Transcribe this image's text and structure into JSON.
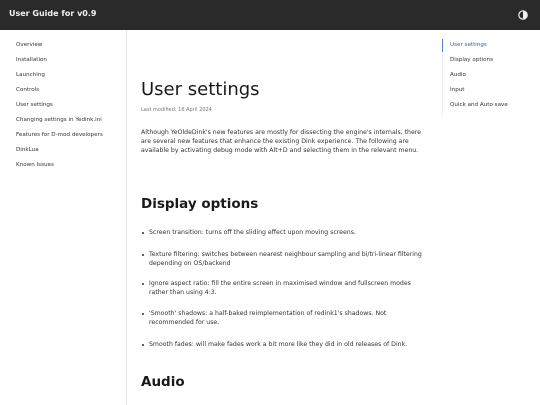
{
  "header": {
    "title": "User Guide for v0.9",
    "theme_toggle_icon": "half-circle-contrast-icon"
  },
  "sidebar": {
    "items": [
      {
        "label": "Overview"
      },
      {
        "label": "Installation"
      },
      {
        "label": "Launching"
      },
      {
        "label": "Controls"
      },
      {
        "label": "User settings"
      },
      {
        "label": "Changing settings in Yedink.ini"
      },
      {
        "label": "Features for D-mod developers"
      },
      {
        "label": "DinkLua"
      },
      {
        "label": "Known Issues"
      }
    ]
  },
  "toc": {
    "items": [
      {
        "label": "User settings",
        "active": true
      },
      {
        "label": "Display options"
      },
      {
        "label": "Audio"
      },
      {
        "label": "Input"
      },
      {
        "label": "Quick and Auto save"
      }
    ],
    "accent": "#4b7fd1"
  },
  "main": {
    "title": "User settings",
    "last_modified": "Last modified: 16 April 2024",
    "intro": "Although YeOldeDink's new features are mostly for dissecting the engine's internals, there are several new features that enhance the existing Dink experience. The following are available by activating debug mode with Alt+D and selecting them in the relevant menu.",
    "display_heading": "Display options",
    "display_items": [
      "Screen transition: turns off the sliding effect upon moving screens.",
      "Texture filtering: switches between nearest neighbour sampling and bi/tri-linear filtering depending on OS/backend",
      "Ignore aspect ratio: fill the entire screen in maximised window and fullscreen modes rather than using 4:3.",
      "'Smooth' shadows: a half-baked reimplementation of redink1's shadows. Not recommended for use.",
      "Smooth fades: will make fades work a bit more like they did in old releases of Dink."
    ],
    "audio_heading": "Audio"
  }
}
